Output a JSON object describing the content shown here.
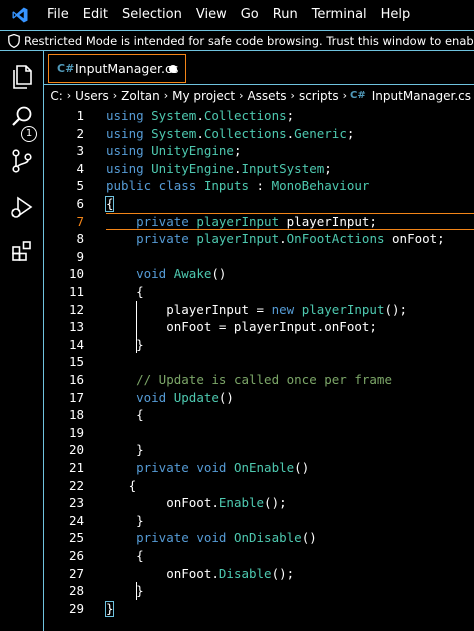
{
  "menu": [
    "File",
    "Edit",
    "Selection",
    "View",
    "Go",
    "Run",
    "Terminal",
    "Help"
  ],
  "banner": {
    "message": "Restricted Mode is intended for safe code browsing. Trust this window to enable all features."
  },
  "activity": {
    "badge_count": "1"
  },
  "tab": {
    "icon": "C#",
    "name": "InputManager.cs"
  },
  "breadcrumb": {
    "items": [
      "C:",
      "Users",
      "Zoltan",
      "My project",
      "Assets",
      "scripts"
    ],
    "file_icon": "C#",
    "file": "InputManager.cs"
  },
  "editor": {
    "cursor_line": 7,
    "lines": [
      {
        "n": "1",
        "tokens": [
          [
            "kw",
            "using "
          ],
          [
            "ty",
            "System"
          ],
          [
            "id",
            "."
          ],
          [
            "ty",
            "Collections"
          ],
          [
            "id",
            ";"
          ]
        ]
      },
      {
        "n": "2",
        "tokens": [
          [
            "kw",
            "using "
          ],
          [
            "ty",
            "System"
          ],
          [
            "id",
            "."
          ],
          [
            "ty",
            "Collections"
          ],
          [
            "id",
            "."
          ],
          [
            "ty",
            "Generic"
          ],
          [
            "id",
            ";"
          ]
        ]
      },
      {
        "n": "3",
        "tokens": [
          [
            "kw",
            "using "
          ],
          [
            "ty",
            "UnityEngine"
          ],
          [
            "id",
            ";"
          ]
        ]
      },
      {
        "n": "4",
        "tokens": [
          [
            "kw",
            "using "
          ],
          [
            "ty",
            "UnityEngine"
          ],
          [
            "id",
            "."
          ],
          [
            "ty",
            "InputSystem"
          ],
          [
            "id",
            ";"
          ]
        ]
      },
      {
        "n": "5",
        "tokens": [
          [
            "kw",
            "public class "
          ],
          [
            "ty",
            "Inputs"
          ],
          [
            "id",
            " : "
          ],
          [
            "ty",
            "MonoBehaviour"
          ]
        ]
      },
      {
        "n": "6",
        "tokens": [
          [
            "id",
            "{"
          ]
        ]
      },
      {
        "n": "7",
        "tokens": [
          [
            "id",
            "    "
          ],
          [
            "kw",
            "private "
          ],
          [
            "ty",
            "playerInput"
          ],
          [
            "id",
            " playerInput;"
          ]
        ]
      },
      {
        "n": "8",
        "tokens": [
          [
            "id",
            "    "
          ],
          [
            "kw",
            "private "
          ],
          [
            "ty",
            "playerInput"
          ],
          [
            "id",
            "."
          ],
          [
            "ty",
            "OnFootActions"
          ],
          [
            "id",
            " onFoot;"
          ]
        ]
      },
      {
        "n": "9",
        "tokens": []
      },
      {
        "n": "10",
        "tokens": [
          [
            "id",
            "    "
          ],
          [
            "kw",
            "void "
          ],
          [
            "ty",
            "Awake"
          ],
          [
            "id",
            "()"
          ]
        ]
      },
      {
        "n": "11",
        "tokens": [
          [
            "id",
            "    {"
          ]
        ]
      },
      {
        "n": "12",
        "tokens": [
          [
            "id",
            "        playerInput = "
          ],
          [
            "kw",
            "new "
          ],
          [
            "ty",
            "playerInput"
          ],
          [
            "id",
            "();"
          ]
        ]
      },
      {
        "n": "13",
        "tokens": [
          [
            "id",
            "        onFoot = playerInput.onFoot;"
          ]
        ]
      },
      {
        "n": "14",
        "tokens": [
          [
            "id",
            "    }"
          ]
        ]
      },
      {
        "n": "15",
        "tokens": []
      },
      {
        "n": "16",
        "tokens": [
          [
            "id",
            "    "
          ],
          [
            "cm",
            "// Update is called once per frame"
          ]
        ]
      },
      {
        "n": "17",
        "tokens": [
          [
            "id",
            "    "
          ],
          [
            "kw",
            "void "
          ],
          [
            "ty",
            "Update"
          ],
          [
            "id",
            "()"
          ]
        ]
      },
      {
        "n": "18",
        "tokens": [
          [
            "id",
            "    {"
          ]
        ]
      },
      {
        "n": "19",
        "tokens": []
      },
      {
        "n": "20",
        "tokens": [
          [
            "id",
            "    }"
          ]
        ]
      },
      {
        "n": "21",
        "tokens": [
          [
            "id",
            "    "
          ],
          [
            "kw",
            "private void "
          ],
          [
            "ty",
            "OnEnable"
          ],
          [
            "id",
            "()"
          ]
        ]
      },
      {
        "n": "22",
        "tokens": [
          [
            "id",
            "   {"
          ]
        ]
      },
      {
        "n": "23",
        "tokens": [
          [
            "id",
            "        onFoot."
          ],
          [
            "ty",
            "Enable"
          ],
          [
            "id",
            "();"
          ]
        ]
      },
      {
        "n": "24",
        "tokens": [
          [
            "id",
            "    }"
          ]
        ]
      },
      {
        "n": "25",
        "tokens": [
          [
            "id",
            "    "
          ],
          [
            "kw",
            "private void "
          ],
          [
            "ty",
            "OnDisable"
          ],
          [
            "id",
            "()"
          ]
        ]
      },
      {
        "n": "26",
        "tokens": [
          [
            "id",
            "    {"
          ]
        ]
      },
      {
        "n": "27",
        "tokens": [
          [
            "id",
            "        onFoot."
          ],
          [
            "ty",
            "Disable"
          ],
          [
            "id",
            "();"
          ]
        ]
      },
      {
        "n": "28",
        "tokens": [
          [
            "id",
            "    }"
          ]
        ]
      },
      {
        "n": "29",
        "tokens": [
          [
            "id",
            "}"
          ]
        ]
      }
    ]
  },
  "colors": {
    "accent_border": "#f38518",
    "contrast_border": "#6fc3df",
    "keyword": "#569cd6",
    "type": "#4ec9b0",
    "comment": "#7ca668"
  },
  "icons": [
    "vscode-logo-icon",
    "shield-icon",
    "explorer-icon",
    "search-icon",
    "source-control-icon",
    "run-debug-icon",
    "extensions-icon",
    "csharp-file-icon",
    "unsaved-dot-icon",
    "chevron-right-icon"
  ]
}
